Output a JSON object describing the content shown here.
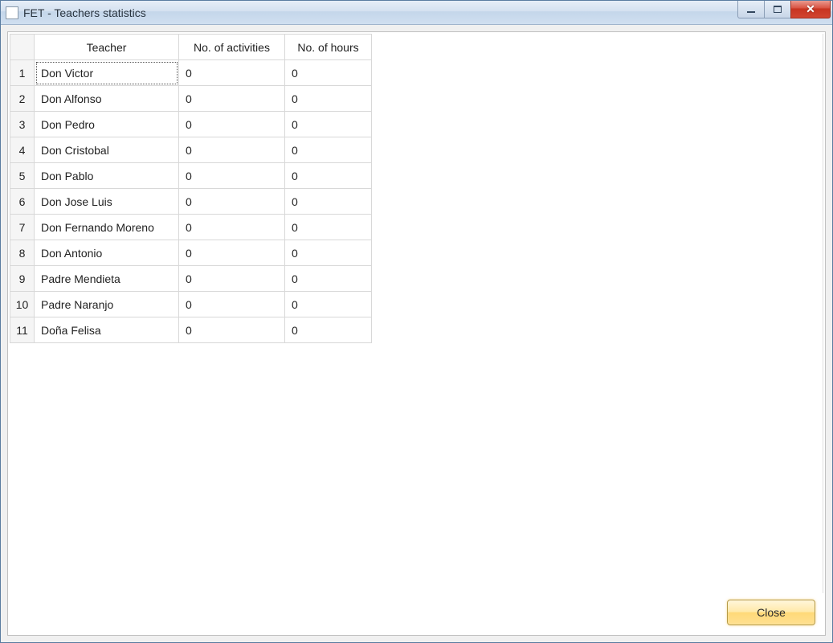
{
  "window": {
    "title": "FET - Teachers statistics"
  },
  "table": {
    "headers": {
      "teacher": "Teacher",
      "activities": "No. of activities",
      "hours": "No. of hours"
    },
    "rows": [
      {
        "idx": "1",
        "teacher": "Don Victor",
        "activities": "0",
        "hours": "0"
      },
      {
        "idx": "2",
        "teacher": "Don Alfonso",
        "activities": "0",
        "hours": "0"
      },
      {
        "idx": "3",
        "teacher": "Don Pedro",
        "activities": "0",
        "hours": "0"
      },
      {
        "idx": "4",
        "teacher": "Don Cristobal",
        "activities": "0",
        "hours": "0"
      },
      {
        "idx": "5",
        "teacher": "Don Pablo",
        "activities": "0",
        "hours": "0"
      },
      {
        "idx": "6",
        "teacher": "Don Jose Luis",
        "activities": "0",
        "hours": "0"
      },
      {
        "idx": "7",
        "teacher": "Don Fernando Moreno",
        "activities": "0",
        "hours": "0"
      },
      {
        "idx": "8",
        "teacher": "Don Antonio",
        "activities": "0",
        "hours": "0"
      },
      {
        "idx": "9",
        "teacher": "Padre Mendieta",
        "activities": "0",
        "hours": "0"
      },
      {
        "idx": "10",
        "teacher": "Padre Naranjo",
        "activities": "0",
        "hours": "0"
      },
      {
        "idx": "11",
        "teacher": "Doña Felisa",
        "activities": "0",
        "hours": "0"
      }
    ]
  },
  "buttons": {
    "close": "Close"
  }
}
